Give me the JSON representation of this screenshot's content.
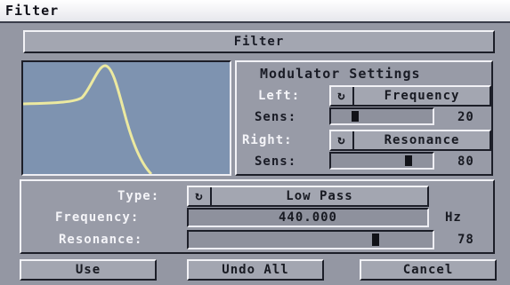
{
  "window": {
    "title": "Filter"
  },
  "header": {
    "label": "Filter"
  },
  "modulator": {
    "heading": "Modulator Settings",
    "left_label": "Left:",
    "left_value": "Frequency",
    "sens1_label": "Sens:",
    "sens1_value": "20",
    "sens1_level": 20,
    "right_label": "Right:",
    "right_value": "Resonance",
    "sens2_label": "Sens:",
    "sens2_value": "80",
    "sens2_level": 80
  },
  "params": {
    "type_label": "Type:",
    "type_value": "Low Pass",
    "frequency_label": "Frequency:",
    "frequency_value": "440.000",
    "frequency_unit": "Hz",
    "resonance_label": "Resonance:",
    "resonance_value": "78",
    "resonance_level": 78
  },
  "buttons": {
    "use": "Use",
    "undo_all": "Undo All",
    "cancel": "Cancel"
  },
  "icons": {
    "cycle": "cycle-gadget-icon"
  },
  "colors": {
    "preview_bg": "#7e93b0",
    "curve": "#ece9a0",
    "window_bg": "#9497a3"
  }
}
